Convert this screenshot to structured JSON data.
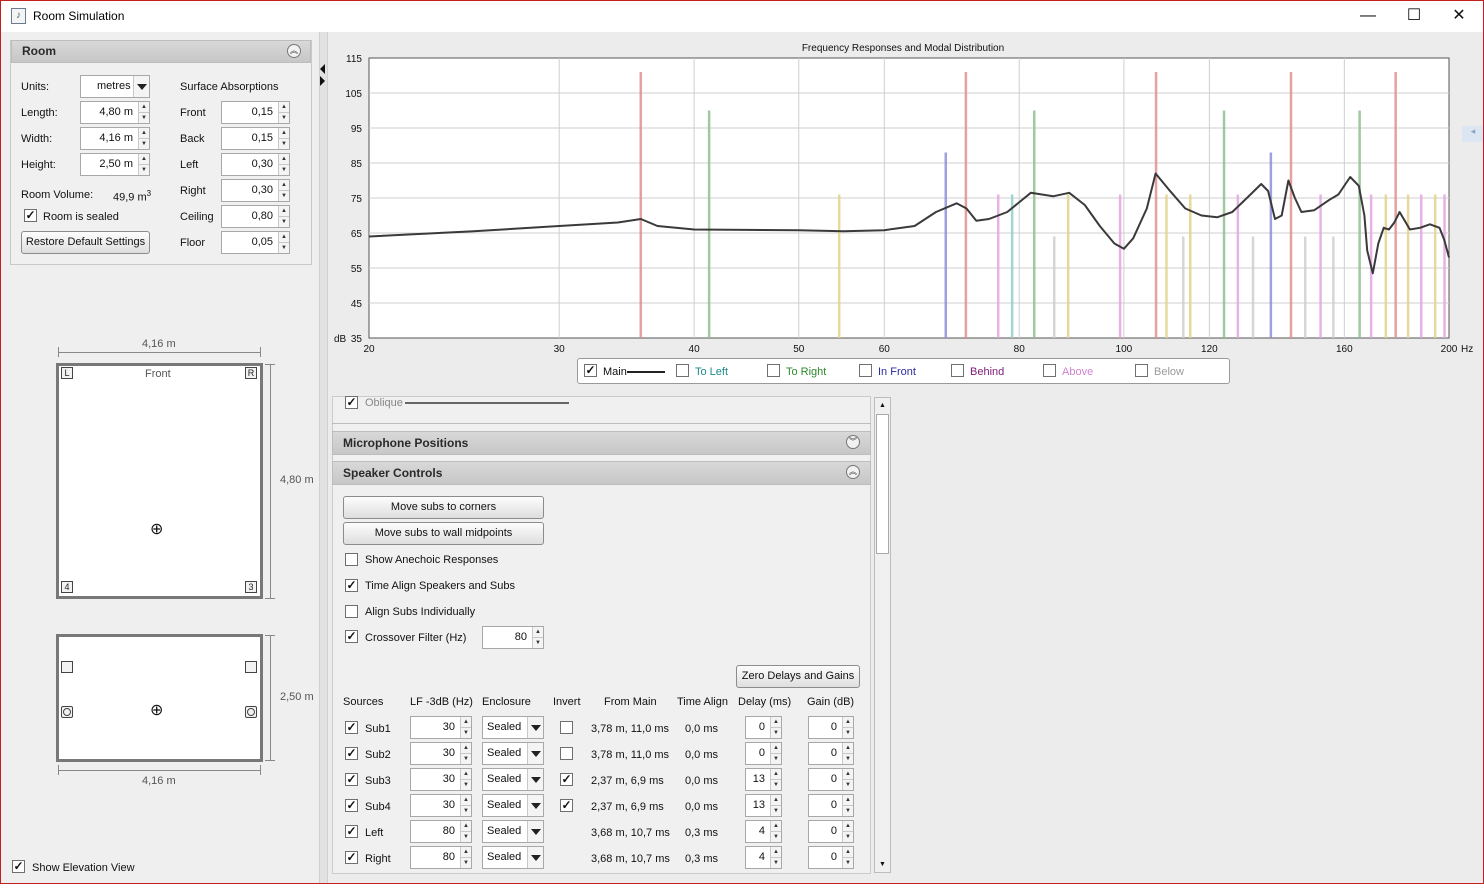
{
  "window": {
    "title": "Room Simulation",
    "minimize": "—",
    "maximize": "☐",
    "close": "✕"
  },
  "room": {
    "header": "Room",
    "units_label": "Units:",
    "units_value": "metres",
    "length_label": "Length:",
    "length_value": "4,80 m",
    "width_label": "Width:",
    "width_value": "4,16 m",
    "height_label": "Height:",
    "height_value": "2,50 m",
    "volume_label": "Room Volume:",
    "volume_value": "49,9 m",
    "volume_unit_sup": "3",
    "sealed_label": "Room is sealed",
    "sealed_checked": "✓",
    "restore_button": "Restore Default Settings",
    "surface_title": "Surface Absorptions",
    "surfaces": [
      {
        "label": "Front",
        "value": "0,15"
      },
      {
        "label": "Back",
        "value": "0,15"
      },
      {
        "label": "Left",
        "value": "0,30"
      },
      {
        "label": "Right",
        "value": "0,30"
      },
      {
        "label": "Ceiling",
        "value": "0,80"
      },
      {
        "label": "Floor",
        "value": "0,05"
      }
    ]
  },
  "plan_view": {
    "width_dim": "4,16 m",
    "length_dim": "4,80 m",
    "front_label": "Front",
    "corner_labels": [
      "L",
      "R",
      "4",
      "3"
    ],
    "listener_icon": "⊕"
  },
  "elevation_view": {
    "height_dim": "2,50 m",
    "width_dim": "4,16 m",
    "show_elevation_label": "Show Elevation View",
    "show_elevation_checked": "✓"
  },
  "chart_data": {
    "type": "line",
    "title": "Frequency Responses and Modal Distribution",
    "x_unit": "Hz",
    "y_unit_label": "dB",
    "x_scale": "log",
    "xlim": [
      20,
      200
    ],
    "ylim": [
      35,
      115
    ],
    "x_ticks": [
      20,
      30,
      40,
      50,
      60,
      80,
      100,
      120,
      160,
      200
    ],
    "y_ticks": [
      115,
      105,
      95,
      85,
      75,
      65,
      55,
      45,
      35
    ],
    "grid": true,
    "series": [
      {
        "name": "Main",
        "color": "#3a3a3a",
        "x": [
          20,
          25,
          30,
          34,
          35.7,
          37,
          40,
          50,
          55,
          60,
          64,
          67,
          70,
          71.5,
          73,
          75,
          78,
          82,
          86,
          89,
          92,
          95,
          98,
          100,
          102,
          105,
          107,
          110,
          114,
          118,
          122,
          126,
          130,
          134,
          136,
          138,
          140,
          142,
          144,
          146,
          150,
          155,
          158,
          162,
          165,
          167,
          168,
          170,
          172,
          174,
          176,
          178,
          180,
          184,
          188,
          192,
          196,
          198,
          200
        ],
        "y": [
          64,
          65.5,
          67,
          68,
          69,
          67,
          66,
          65.8,
          65.5,
          65.8,
          67,
          71,
          73.5,
          72,
          68.5,
          69,
          71,
          76.5,
          75.5,
          76.5,
          73,
          67,
          62,
          60.5,
          63.5,
          72,
          82,
          77.5,
          72,
          70,
          69.5,
          71,
          75,
          79,
          77,
          69,
          70,
          80,
          75,
          71,
          71.5,
          74.5,
          76,
          81,
          78.5,
          70,
          60,
          53.5,
          62,
          66.5,
          66,
          68,
          71,
          66,
          66.5,
          67.5,
          66.5,
          63,
          58
        ]
      }
    ],
    "modes": [
      {
        "freq": 35.7,
        "db": 111,
        "color": "#e08f8f"
      },
      {
        "freq": 41.3,
        "db": 100,
        "color": "#8fbf8f"
      },
      {
        "freq": 54.5,
        "db": 76,
        "color": "#e3d28a"
      },
      {
        "freq": 68.4,
        "db": 88,
        "color": "#8f8fd9"
      },
      {
        "freq": 71.4,
        "db": 111,
        "color": "#e08f8f"
      },
      {
        "freq": 76.5,
        "db": 76,
        "color": "#e3a6e0"
      },
      {
        "freq": 78.8,
        "db": 76,
        "color": "#8fcfcf"
      },
      {
        "freq": 82.6,
        "db": 100,
        "color": "#8fbf8f"
      },
      {
        "freq": 86.2,
        "db": 64,
        "color": "#cfcfcf"
      },
      {
        "freq": 88.8,
        "db": 76,
        "color": "#e3d28a"
      },
      {
        "freq": 99.2,
        "db": 76,
        "color": "#e3a6e0"
      },
      {
        "freq": 107.1,
        "db": 111,
        "color": "#e08f8f"
      },
      {
        "freq": 109.5,
        "db": 76,
        "color": "#e3d28a"
      },
      {
        "freq": 113.5,
        "db": 64,
        "color": "#cfcfcf"
      },
      {
        "freq": 115.2,
        "db": 76,
        "color": "#e3d28a"
      },
      {
        "freq": 123.8,
        "db": 100,
        "color": "#8fbf8f"
      },
      {
        "freq": 127.5,
        "db": 76,
        "color": "#e3a6e0"
      },
      {
        "freq": 131.7,
        "db": 64,
        "color": "#cfcfcf"
      },
      {
        "freq": 136.8,
        "db": 88,
        "color": "#8f8fd9"
      },
      {
        "freq": 142.8,
        "db": 111,
        "color": "#e08f8f"
      },
      {
        "freq": 147.2,
        "db": 64,
        "color": "#cfcfcf"
      },
      {
        "freq": 152.1,
        "db": 76,
        "color": "#e3a6e0"
      },
      {
        "freq": 156.3,
        "db": 64,
        "color": "#cfcfcf"
      },
      {
        "freq": 165.3,
        "db": 100,
        "color": "#8fbf8f"
      },
      {
        "freq": 169.4,
        "db": 76,
        "color": "#e3a6e0"
      },
      {
        "freq": 174.8,
        "db": 76,
        "color": "#e3d28a"
      },
      {
        "freq": 178.5,
        "db": 111,
        "color": "#e08f8f"
      },
      {
        "freq": 183.3,
        "db": 76,
        "color": "#e3d28a"
      },
      {
        "freq": 188.5,
        "db": 76,
        "color": "#e3a6e0"
      },
      {
        "freq": 194.2,
        "db": 76,
        "color": "#e3d28a"
      },
      {
        "freq": 198.1,
        "db": 76,
        "color": "#e3a6e0"
      }
    ],
    "legend": [
      {
        "label": "Main",
        "checked": "✓",
        "color": "#111111"
      },
      {
        "label": "To Left",
        "checked": "",
        "color": "#1d8a8a"
      },
      {
        "label": "To Right",
        "checked": "",
        "color": "#2a8a2a"
      },
      {
        "label": "In Front",
        "checked": "",
        "color": "#2a2aa0"
      },
      {
        "label": "Behind",
        "checked": "",
        "color": "#7a1a7a"
      },
      {
        "label": "Above",
        "checked": "",
        "color": "#d083d0"
      },
      {
        "label": "Below",
        "checked": "",
        "color": "#9a9a9a"
      }
    ]
  },
  "oblique": {
    "label": "Oblique",
    "checked": "✓"
  },
  "microphone": {
    "header": "Microphone Positions"
  },
  "speaker": {
    "header": "Speaker Controls",
    "move_corners": "Move subs to corners",
    "move_midpoints": "Move subs to wall midpoints",
    "show_anechoic": {
      "label": "Show Anechoic Responses",
      "checked": ""
    },
    "time_align": {
      "label": "Time Align Speakers and Subs",
      "checked": "✓"
    },
    "align_individually": {
      "label": "Align Subs Individually",
      "checked": ""
    },
    "crossover": {
      "label": "Crossover Filter (Hz)",
      "checked": "✓",
      "value": "80"
    },
    "zero_button": "Zero Delays and Gains",
    "columns": [
      "Sources",
      "LF -3dB (Hz)",
      "Enclosure",
      "Invert",
      "From Main",
      "Time Align",
      "Delay (ms)",
      "Gain (dB)"
    ],
    "rows": [
      {
        "checked": "✓",
        "name": "Sub1",
        "lf": "30",
        "enclosure": "Sealed",
        "invert": "",
        "has_invert": true,
        "from_main": "3,78 m, 11,0 ms",
        "time_align": "0,0 ms",
        "delay": "0",
        "gain": "0"
      },
      {
        "checked": "✓",
        "name": "Sub2",
        "lf": "30",
        "enclosure": "Sealed",
        "invert": "",
        "has_invert": true,
        "from_main": "3,78 m, 11,0 ms",
        "time_align": "0,0 ms",
        "delay": "0",
        "gain": "0"
      },
      {
        "checked": "✓",
        "name": "Sub3",
        "lf": "30",
        "enclosure": "Sealed",
        "invert": "✓",
        "has_invert": true,
        "from_main": "2,37 m, 6,9 ms",
        "time_align": "0,0 ms",
        "delay": "13",
        "gain": "0"
      },
      {
        "checked": "✓",
        "name": "Sub4",
        "lf": "30",
        "enclosure": "Sealed",
        "invert": "✓",
        "has_invert": true,
        "from_main": "2,37 m, 6,9 ms",
        "time_align": "0,0 ms",
        "delay": "13",
        "gain": "0"
      },
      {
        "checked": "✓",
        "name": "Left",
        "lf": "80",
        "enclosure": "Sealed",
        "invert": "",
        "has_invert": false,
        "from_main": "3,68 m, 10,7 ms",
        "time_align": "0,3 ms",
        "delay": "4",
        "gain": "0"
      },
      {
        "checked": "✓",
        "name": "Right",
        "lf": "80",
        "enclosure": "Sealed",
        "invert": "",
        "has_invert": false,
        "from_main": "3,68 m, 10,7 ms",
        "time_align": "0,3 ms",
        "delay": "4",
        "gain": "0"
      }
    ]
  }
}
